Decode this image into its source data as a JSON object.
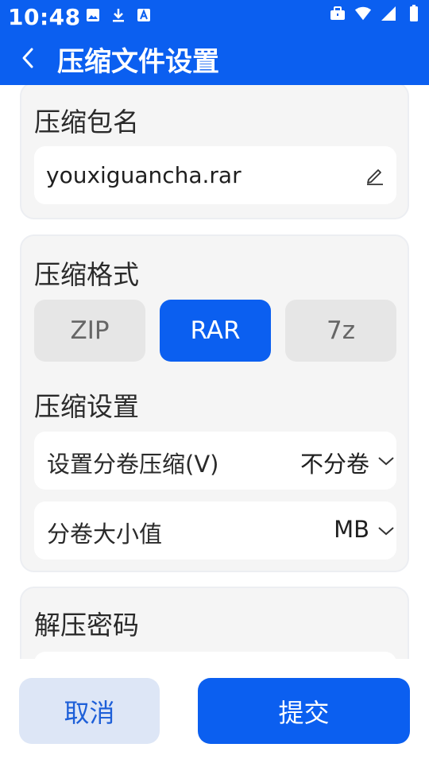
{
  "status_bar": {
    "time": "10:48",
    "left_icons": [
      "image-icon",
      "download-icon",
      "font-icon"
    ],
    "right_icons": [
      "briefcase-icon",
      "wifi-icon",
      "signal-icon",
      "battery-icon"
    ]
  },
  "header": {
    "title": "压缩文件设置",
    "back_icon": "back-arrow-icon",
    "background": "#0b5ff0"
  },
  "archive_name": {
    "title": "压缩包名",
    "value": "youxiguancha.rar",
    "edit_icon": "edit-icon"
  },
  "format": {
    "title": "压缩格式",
    "options": [
      "ZIP",
      "RAR",
      "7z"
    ],
    "selected": "RAR"
  },
  "compression_settings": {
    "title": "压缩设置",
    "split_label": "设置分卷压缩(V)",
    "split_value": "不分卷",
    "size_label": "分卷大小值",
    "size_value": "MB"
  },
  "password": {
    "title": "解压密码"
  },
  "footer": {
    "cancel_label": "取消",
    "submit_label": "提交"
  }
}
